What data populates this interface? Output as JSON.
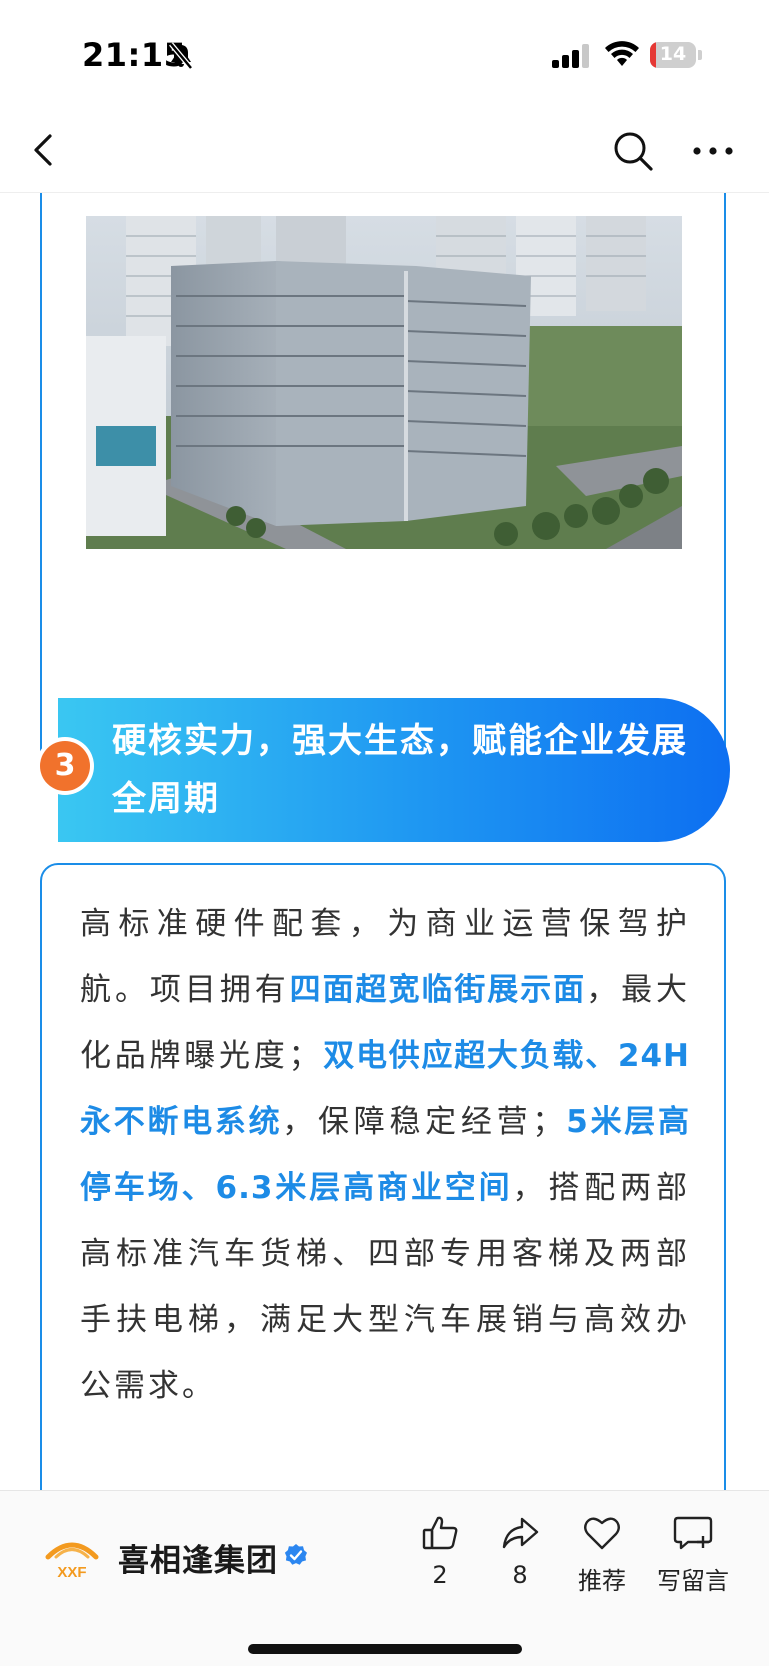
{
  "status_bar": {
    "time": "21:15",
    "battery_level": "14",
    "battery_color": "#e53935"
  },
  "nav": {
    "back_icon": "chevron-left-icon",
    "search_icon": "search-icon",
    "more_icon": "more-icon"
  },
  "article": {
    "image_icon": "building-photo",
    "section": {
      "number": "3",
      "title": "硬核实力，强大生态，赋能企业发展全周期"
    },
    "paragraph": [
      {
        "text": "高标准硬件配套，为商业运营保驾护航。项目拥有",
        "highlight": false
      },
      {
        "text": "四面超宽临街展示面",
        "highlight": true
      },
      {
        "text": "，最大化品牌曝光度；",
        "highlight": false
      },
      {
        "text": "双电供应超大负载、24H永不断电系统",
        "highlight": true
      },
      {
        "text": "，保障稳定经营；",
        "highlight": false
      },
      {
        "text": "5米层高停车场、6.3米层高商业空间",
        "highlight": true
      },
      {
        "text": "，搭配两部高标准汽车货梯、四部专用客梯及两部手扶电梯，满足大型汽车展销与高效办公需求。",
        "highlight": false
      }
    ],
    "accent_color": "#1d8be6"
  },
  "footer": {
    "account_name": "喜相逢集团",
    "logo_text": "XXF",
    "actions": [
      {
        "icon": "thumbs-up-icon",
        "label": "2"
      },
      {
        "icon": "share-icon",
        "label": "8"
      },
      {
        "icon": "heart-icon",
        "label": "推荐"
      },
      {
        "icon": "comment-icon",
        "label": "写留言"
      }
    ]
  }
}
